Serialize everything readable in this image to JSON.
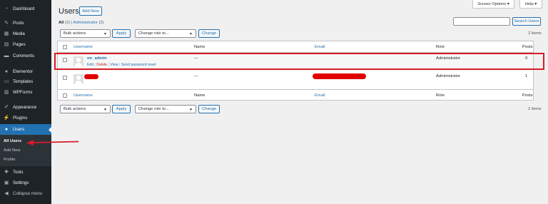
{
  "sidebar": {
    "items": [
      {
        "label": "Dashboard",
        "icon": "dashboard-icon",
        "glyph": "◔"
      },
      {
        "label": "Posts",
        "icon": "pin-icon",
        "glyph": "✎"
      },
      {
        "label": "Media",
        "icon": "media-icon",
        "glyph": "▦"
      },
      {
        "label": "Pages",
        "icon": "pages-icon",
        "glyph": "▤"
      },
      {
        "label": "Comments",
        "icon": "comment-icon",
        "glyph": "▬"
      },
      {
        "label": "Elementor",
        "icon": "elementor-icon",
        "glyph": "●"
      },
      {
        "label": "Templates",
        "icon": "templates-icon",
        "glyph": "▭"
      },
      {
        "label": "WPForms",
        "icon": "wpforms-icon",
        "glyph": "▥"
      },
      {
        "label": "Appearance",
        "icon": "brush-icon",
        "glyph": "✐"
      },
      {
        "label": "Plugins",
        "icon": "plug-icon",
        "glyph": "⚡"
      },
      {
        "label": "Users",
        "icon": "user-icon",
        "glyph": "●"
      },
      {
        "label": "Tools",
        "icon": "wrench-icon",
        "glyph": "✚"
      },
      {
        "label": "Settings",
        "icon": "settings-icon",
        "glyph": "▣"
      },
      {
        "label": "Collapse menu",
        "icon": "collapse-icon",
        "glyph": "◀"
      }
    ],
    "submenu": [
      "All Users",
      "Add New",
      "Profile"
    ]
  },
  "header": {
    "title": "Users",
    "add_new": "Add New",
    "screen_options": "Screen Options ▾",
    "help": "Help ▾"
  },
  "filters": {
    "all": "All",
    "all_count": "(2)",
    "sep": "|",
    "administrator": "Administrator",
    "administrator_count": "(2)"
  },
  "search": {
    "button": "Search Users",
    "value": ""
  },
  "bulk": {
    "actions": "Bulk actions",
    "apply": "Apply",
    "change_role": "Change role to...",
    "change": "Change"
  },
  "items_count": "2 items",
  "columns": {
    "username": "Username",
    "name": "Name",
    "email": "Email",
    "role": "Role",
    "posts": "Posts"
  },
  "rows": [
    {
      "username": "mr_admin",
      "name": "—",
      "email": "",
      "role": "Administrator",
      "posts": "0",
      "actions": [
        "Edit",
        "Delete",
        "View",
        "Send password reset"
      ]
    },
    {
      "username": "",
      "name": "—",
      "email": "",
      "role": "Administrator",
      "posts": "1"
    }
  ],
  "colors": {
    "sidebar_bg": "#1d2327",
    "accent": "#2271b1",
    "highlight": "#d81c24"
  }
}
